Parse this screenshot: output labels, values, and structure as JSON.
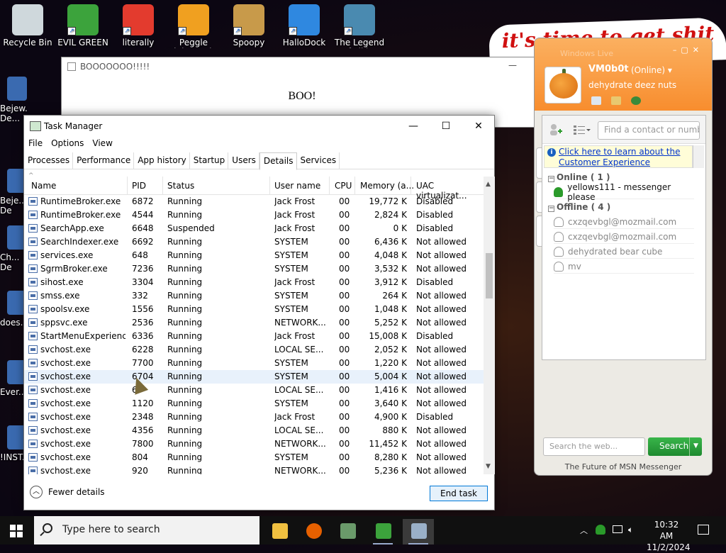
{
  "desktop": {
    "icons": [
      {
        "label": "Recycle Bin",
        "name": "recycle-bin-icon",
        "color": "#cfd8dc"
      },
      {
        "label": "EVIL GREEN MSN GO...",
        "name": "msn-buddy-icon",
        "color": "#3ca33c"
      },
      {
        "label": "literally",
        "name": "chrome-icon",
        "color": "#e33b2e"
      },
      {
        "label": "Peggle Nights Del...",
        "name": "peggle-icon",
        "color": "#f0a020"
      },
      {
        "label": "Spoopy",
        "name": "folder-icon",
        "color": "#c89a4a"
      },
      {
        "label": "HalloDock",
        "name": "windows-logo-icon",
        "color": "#2f88e0"
      },
      {
        "label": "The Legend of Tiki...",
        "name": "game-character-icon",
        "color": "#4a8ab0"
      }
    ],
    "left_partial": [
      "Bejew... De...",
      "Beje... De",
      "Ch... De",
      "does...",
      "Ever...",
      "!INST..."
    ],
    "banner": "it's time to get shit"
  },
  "boo_window": {
    "title": "BOOOOOOO!!!!!",
    "text": "BOO!",
    "minimize": "—"
  },
  "msn": {
    "title": "Windows Live",
    "username": "VM0b0t",
    "status": "(Online)",
    "status_arrow": "▾",
    "personal_message": "dehydrate deez nuts",
    "find_placeholder": "Find a contact or number...",
    "promo_text": "Click here to learn about the Customer Experience",
    "groups": {
      "online": {
        "label": "Online ( 1 )",
        "contacts": [
          "yellows111 - messenger please"
        ]
      },
      "offline": {
        "label": "Offline ( 4 )",
        "contacts": [
          "cxzqevbgl@mozmail.com",
          "cxzqevbgl@mozmail.com",
          "dehydrated bear cube",
          "mv"
        ]
      }
    },
    "search_placeholder": "Search the web...",
    "search_button": "Search",
    "footer": "The Future of MSN Messenger",
    "accent": "#f88d2e"
  },
  "task_manager": {
    "title": "Task Manager",
    "window_buttons": {
      "minimize": "—",
      "maximize": "☐",
      "close": "✕"
    },
    "menu": [
      "File",
      "Options",
      "View"
    ],
    "tabs": [
      "Processes",
      "Performance",
      "App history",
      "Startup",
      "Users",
      "Details",
      "Services"
    ],
    "active_tab": "Details",
    "columns": [
      "Name",
      "PID",
      "Status",
      "User name",
      "CPU",
      "Memory (a...",
      "UAC virtualizat..."
    ],
    "rows": [
      [
        "RuntimeBroker.exe",
        "6872",
        "Running",
        "Jack Frost",
        "00",
        "19,772 K",
        "Disabled"
      ],
      [
        "RuntimeBroker.exe",
        "4544",
        "Running",
        "Jack Frost",
        "00",
        "2,824 K",
        "Disabled"
      ],
      [
        "SearchApp.exe",
        "6648",
        "Suspended",
        "Jack Frost",
        "00",
        "0 K",
        "Disabled"
      ],
      [
        "SearchIndexer.exe",
        "6692",
        "Running",
        "SYSTEM",
        "00",
        "6,436 K",
        "Not allowed"
      ],
      [
        "services.exe",
        "648",
        "Running",
        "SYSTEM",
        "00",
        "4,048 K",
        "Not allowed"
      ],
      [
        "SgrmBroker.exe",
        "7236",
        "Running",
        "SYSTEM",
        "00",
        "3,532 K",
        "Not allowed"
      ],
      [
        "sihost.exe",
        "3304",
        "Running",
        "Jack Frost",
        "00",
        "3,912 K",
        "Disabled"
      ],
      [
        "smss.exe",
        "332",
        "Running",
        "SYSTEM",
        "00",
        "264 K",
        "Not allowed"
      ],
      [
        "spoolsv.exe",
        "1556",
        "Running",
        "SYSTEM",
        "00",
        "1,048 K",
        "Not allowed"
      ],
      [
        "sppsvc.exe",
        "2536",
        "Running",
        "NETWORK...",
        "00",
        "5,252 K",
        "Not allowed"
      ],
      [
        "StartMenuExperienc...",
        "6336",
        "Running",
        "Jack Frost",
        "00",
        "15,008 K",
        "Disabled"
      ],
      [
        "svchost.exe",
        "6228",
        "Running",
        "LOCAL SE...",
        "00",
        "2,052 K",
        "Not allowed"
      ],
      [
        "svchost.exe",
        "7700",
        "Running",
        "SYSTEM",
        "00",
        "1,220 K",
        "Not allowed"
      ],
      [
        "svchost.exe",
        "6704",
        "Running",
        "SYSTEM",
        "00",
        "5,004 K",
        "Not allowed"
      ],
      [
        "svchost.exe",
        "6",
        "Running",
        "LOCAL SE...",
        "00",
        "1,416 K",
        "Not allowed"
      ],
      [
        "svchost.exe",
        "1120",
        "Running",
        "SYSTEM",
        "00",
        "3,640 K",
        "Not allowed"
      ],
      [
        "svchost.exe",
        "2348",
        "Running",
        "Jack Frost",
        "00",
        "4,900 K",
        "Disabled"
      ],
      [
        "svchost.exe",
        "4356",
        "Running",
        "LOCAL SE...",
        "00",
        "880 K",
        "Not allowed"
      ],
      [
        "svchost.exe",
        "7800",
        "Running",
        "NETWORK...",
        "00",
        "11,452 K",
        "Not allowed"
      ],
      [
        "svchost.exe",
        "804",
        "Running",
        "SYSTEM",
        "00",
        "8,280 K",
        "Not allowed"
      ],
      [
        "svchost.exe",
        "920",
        "Running",
        "NETWORK...",
        "00",
        "5,236 K",
        "Not allowed"
      ]
    ],
    "selected_row": 13,
    "fewer_details": "Fewer details",
    "end_task": "End task"
  },
  "taskbar": {
    "search_placeholder": "Type here to search",
    "apps": [
      {
        "name": "file-explorer-icon",
        "color": "#f0c040"
      },
      {
        "name": "firefox-icon",
        "color": "#e66000"
      },
      {
        "name": "notepad-app-icon",
        "color": "#6a9a6a"
      },
      {
        "name": "msn-messenger-icon",
        "color": "#3ca33c"
      },
      {
        "name": "task-manager-icon",
        "color": "#9ab0c8"
      }
    ],
    "time": "10:32 AM",
    "date": "11/2/2024"
  }
}
